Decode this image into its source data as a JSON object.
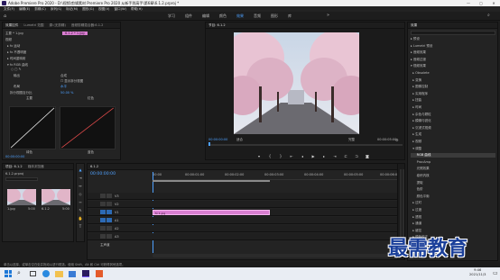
{
  "window": {
    "title": "Adobe Premiere Pro 2020 - D:\\视频\\剪辑素材 Premiere Pro 2020 从新手到高手\\第6章\\6.1.2.prproj *",
    "min": "—",
    "max": "▢",
    "close": "✕"
  },
  "menu": [
    "文件(F)",
    "编辑(E)",
    "剪辑(C)",
    "序列(S)",
    "标记(M)",
    "图形(G)",
    "视图(V)",
    "窗口(W)",
    "帮助(H)"
  ],
  "workspaces": [
    "学习",
    "组件",
    "编辑",
    "颜色",
    "效果",
    "音频",
    "图形",
    "库"
  ],
  "active_workspace": "效果",
  "effect_controls": {
    "tabs": [
      "效果控件",
      "Lumetri 范围",
      "源:(无剪辑)",
      "音频剪辑混合器:6.1.2"
    ],
    "clip_label": "主要 * 1.jpg",
    "clip_tag": "6.1.2 * 1.jpg",
    "rows": [
      "视频",
      "▸ fx 运动",
      "▸ fx 不透明度",
      "▸ 时间重映射",
      "▾ fx RGB 曲线"
    ],
    "output_label": "输出",
    "output_value": "合成",
    "show_split": "显示拆分视图",
    "layout_label": "布局",
    "layout_value": "水平",
    "split_label": "拆分视图百分比",
    "split_value": "50.00 %",
    "master_label": "主要",
    "red_label": "红色",
    "green_label": "绿色",
    "blue_label": "蓝色",
    "time": "00:00:00:00"
  },
  "program": {
    "tab": "节目: 6.1.2",
    "timecode_left": "00:00:00:00",
    "fit": "适合",
    "quality": "完整",
    "timecode_right": "00:00:05:00"
  },
  "project": {
    "tabs": [
      "项目: 6.1.2",
      "媒体浏览器"
    ],
    "path": "6.1.2.prproj",
    "items": [
      {
        "name": "1.jpg",
        "dur": "5:00"
      },
      {
        "name": "6.1.2",
        "dur": "5:00"
      }
    ]
  },
  "timeline": {
    "tab": "6.1.2",
    "timecode": "00:00:00:00",
    "ruler": [
      "00:00",
      "00:00:01:00",
      "00:00:02:00",
      "00:00:03:00",
      "00:00:04:00",
      "00:00:05:00",
      "00:00:06:00"
    ],
    "tracks": [
      "V3",
      "V2",
      "V1",
      "A1",
      "A2",
      "A3"
    ],
    "master": "主声道",
    "clip_label": "fx 1.jpg"
  },
  "effects": {
    "tab": "效果",
    "items": [
      "▸ 预设",
      "▸ Lumetri 预设",
      "▸ 音频效果",
      "▸ 音频过渡",
      "▾ 视频效果",
      "  ▸ Obsolete",
      "  ▸ 变换",
      "  ▸ 图像控制",
      "  ▸ 实用程序",
      "  ▸ 扭曲",
      "  ▸ 时间",
      "  ▸ 杂色与颗粒",
      "  ▸ 模糊与锐化",
      "  ▸ 沉浸式视频",
      "  ▸ 生成",
      "  ▸ 视频",
      "  ▾ 调整",
      "      RGB 曲线",
      "      ProcAmp",
      "      光照效果",
      "      卷积内核",
      "      提取",
      "      色阶",
      "      颜色平衡",
      "  ▸ 过时",
      "  ▸ 过渡",
      "  ▸ 透视",
      "  ▸ 通道",
      "  ▸ 键控",
      "  ▸ 颜色校正",
      "  ▸ 风格化",
      "▸ 视频过渡"
    ],
    "highlight_index": 17
  },
  "status": "单击以选择，或单击空白处并拖动以进行框选。使用 Shift、Alt 和 Ctrl 可获得其他选项。",
  "watermark": "最需教育",
  "taskbar": {
    "time": "9:46",
    "date": "2021/11/3"
  }
}
